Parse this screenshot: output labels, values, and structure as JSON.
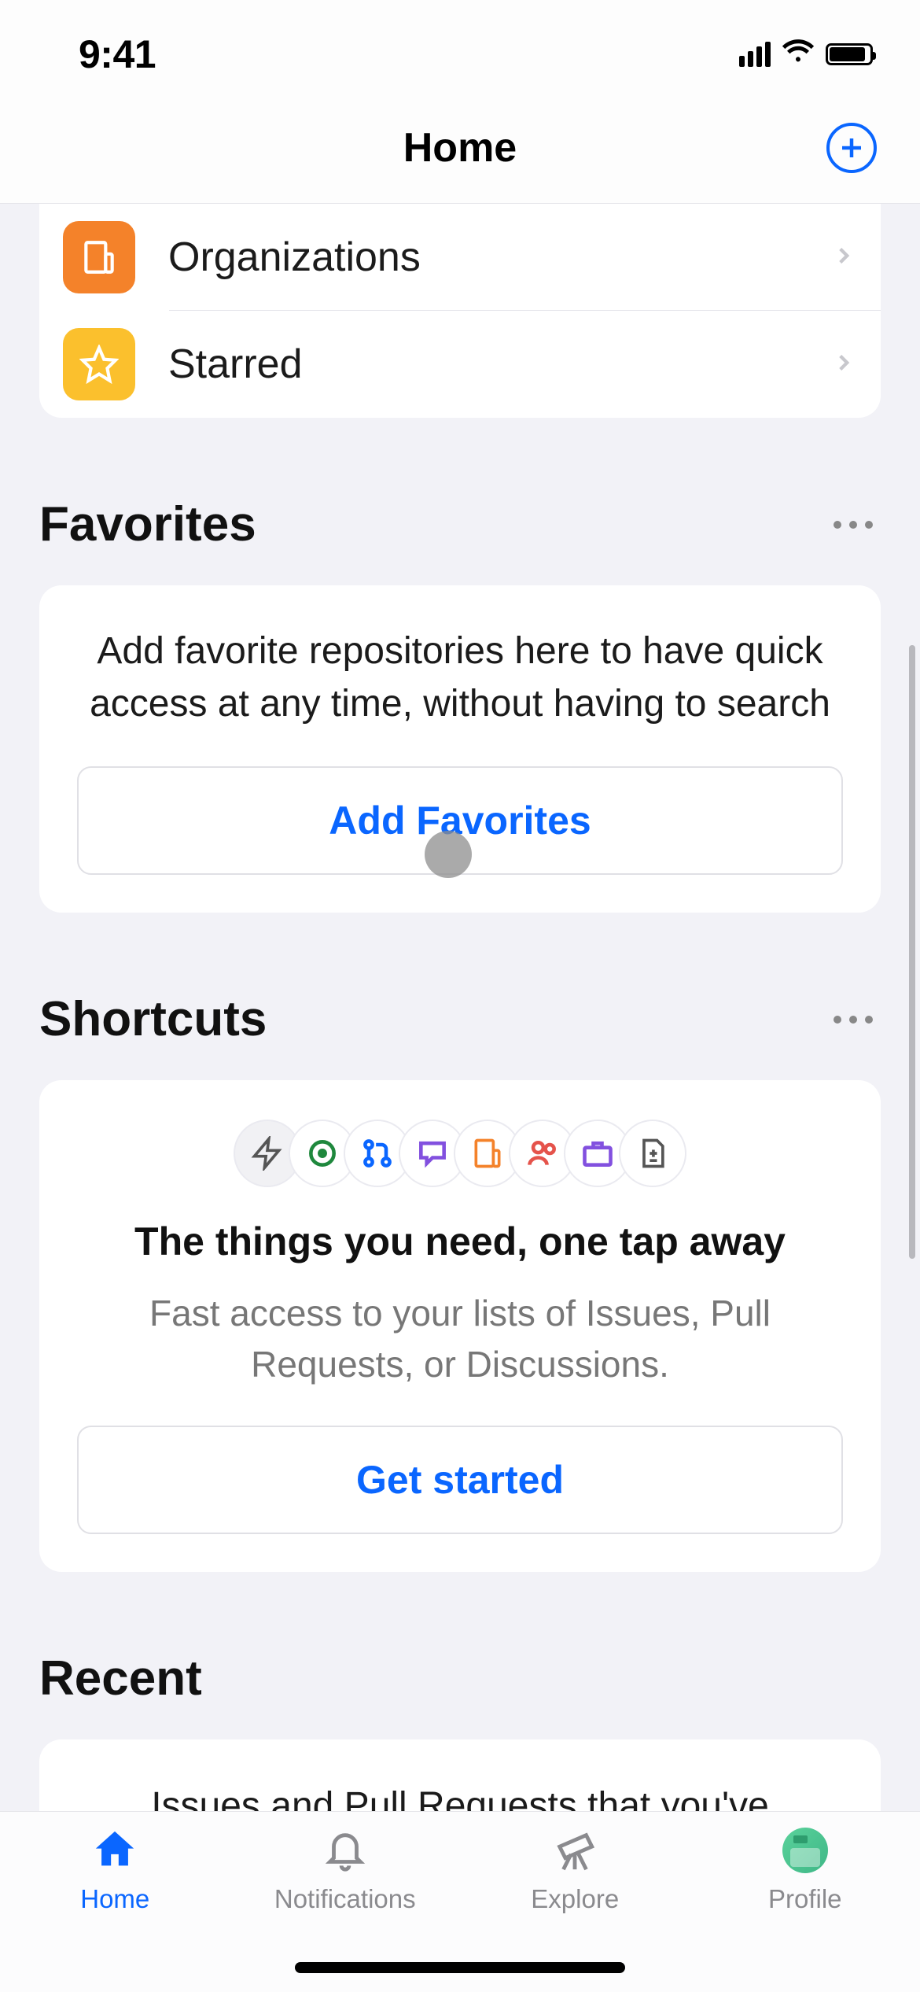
{
  "status": {
    "time": "9:41"
  },
  "nav": {
    "title": "Home"
  },
  "list": {
    "items": [
      {
        "label": "Organizations",
        "icon": "organization-icon",
        "color": "orange"
      },
      {
        "label": "Starred",
        "icon": "star-icon",
        "color": "yellow"
      }
    ]
  },
  "favorites": {
    "header": "Favorites",
    "empty": "Add favorite repositories here to have quick access at any time, without having to search",
    "action": "Add Favorites"
  },
  "shortcuts": {
    "header": "Shortcuts",
    "title": "The things you need, one tap away",
    "subtitle": "Fast access to your lists of Issues, Pull Requests, or Discussions.",
    "action": "Get started",
    "icons": [
      "lightning-icon",
      "dot-circle-icon",
      "pull-request-icon",
      "discussion-icon",
      "organization-icon",
      "people-icon",
      "briefcase-icon",
      "file-diff-icon"
    ]
  },
  "recent": {
    "header": "Recent",
    "text": "Issues and Pull Requests that you've"
  },
  "tabs": {
    "items": [
      {
        "label": "Home",
        "icon": "home-icon",
        "active": true
      },
      {
        "label": "Notifications",
        "icon": "bell-icon",
        "active": false
      },
      {
        "label": "Explore",
        "icon": "telescope-icon",
        "active": false
      },
      {
        "label": "Profile",
        "icon": "avatar-icon",
        "active": false
      }
    ]
  }
}
